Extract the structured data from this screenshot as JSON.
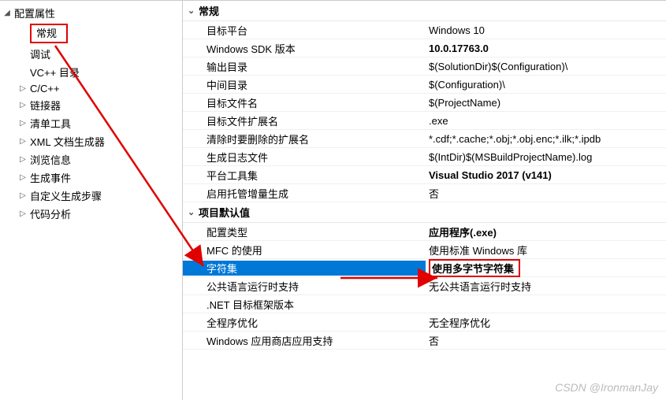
{
  "tree": {
    "root": "配置属性",
    "items": [
      {
        "label": "常规",
        "highlighted": true
      },
      {
        "label": "调试"
      },
      {
        "label": "VC++ 目录"
      },
      {
        "label": "C/C++",
        "expandable": true
      },
      {
        "label": "链接器",
        "expandable": true
      },
      {
        "label": "清单工具",
        "expandable": true
      },
      {
        "label": "XML 文档生成器",
        "expandable": true
      },
      {
        "label": "浏览信息",
        "expandable": true
      },
      {
        "label": "生成事件",
        "expandable": true
      },
      {
        "label": "自定义生成步骤",
        "expandable": true
      },
      {
        "label": "代码分析",
        "expandable": true
      }
    ]
  },
  "sections": [
    {
      "title": "常规",
      "rows": [
        {
          "key": "目标平台",
          "val": "Windows 10"
        },
        {
          "key": "Windows SDK 版本",
          "val": "10.0.17763.0",
          "bold": true
        },
        {
          "key": "输出目录",
          "val": "$(SolutionDir)$(Configuration)\\"
        },
        {
          "key": "中间目录",
          "val": "$(Configuration)\\"
        },
        {
          "key": "目标文件名",
          "val": "$(ProjectName)"
        },
        {
          "key": "目标文件扩展名",
          "val": ".exe"
        },
        {
          "key": "清除时要删除的扩展名",
          "val": "*.cdf;*.cache;*.obj;*.obj.enc;*.ilk;*.ipdb"
        },
        {
          "key": "生成日志文件",
          "val": "$(IntDir)$(MSBuildProjectName).log"
        },
        {
          "key": "平台工具集",
          "val": "Visual Studio 2017 (v141)",
          "bold": true
        },
        {
          "key": "启用托管增量生成",
          "val": "否"
        }
      ]
    },
    {
      "title": "项目默认值",
      "rows": [
        {
          "key": "配置类型",
          "val": "应用程序(.exe)",
          "bold": true
        },
        {
          "key": "MFC 的使用",
          "val": "使用标准 Windows 库"
        },
        {
          "key": "字符集",
          "val": "使用多字节字符集",
          "selected": true,
          "bold": true,
          "highlightVal": true
        },
        {
          "key": "公共语言运行时支持",
          "val": "无公共语言运行时支持"
        },
        {
          "key": ".NET 目标框架版本",
          "val": ""
        },
        {
          "key": "全程序优化",
          "val": "无全程序优化"
        },
        {
          "key": "Windows 应用商店应用支持",
          "val": "否"
        }
      ]
    }
  ],
  "watermark": "CSDN @IronmanJay"
}
